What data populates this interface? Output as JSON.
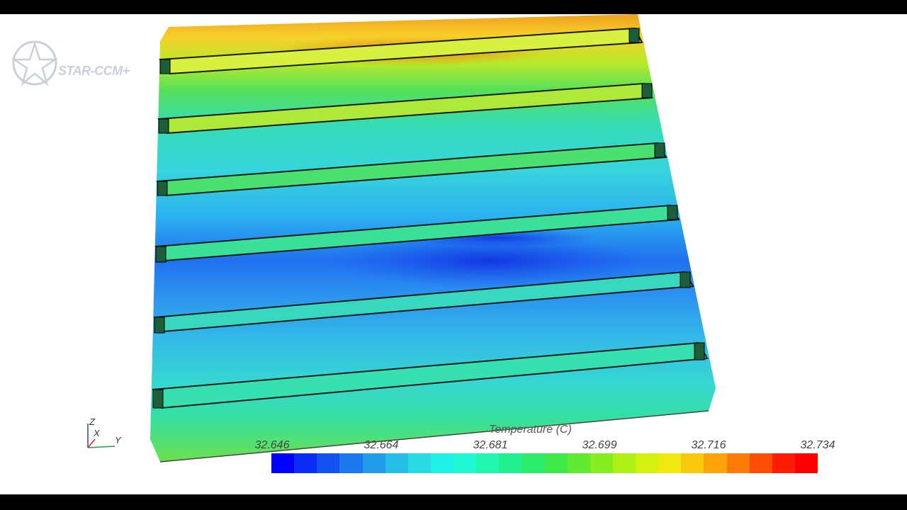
{
  "app": {
    "logo_text": "STAR-CCM+"
  },
  "axes": {
    "z": "Z",
    "x": "X",
    "y": "Y"
  },
  "legend": {
    "title": "Temperature (C)",
    "ticks": [
      "32.646",
      "32.664",
      "32.681",
      "32.699",
      "32.716",
      "32.734"
    ],
    "colors": [
      "#0000ff",
      "#0a2cf5",
      "#1352f0",
      "#1c78ec",
      "#229be8",
      "#25bde4",
      "#28d9e2",
      "#20f0e6",
      "#1ff8d0",
      "#22f5ae",
      "#23f08e",
      "#2aeb6a",
      "#3ee848",
      "#60ea30",
      "#86ee20",
      "#aef016",
      "#d4f010",
      "#f0e80e",
      "#f8c80c",
      "#fca40a",
      "#fd7c08",
      "#fe4e06",
      "#ff1c04",
      "#ff0000"
    ]
  },
  "scene": {
    "bands": [
      "#f7b400",
      "#9be022",
      "#30e09a",
      "#3ad6d4",
      "#2ab0f0",
      "#1f7ef2",
      "#1a5ef0",
      "#2a9cf2",
      "#35c6e8",
      "#34dcc8",
      "#2fe08a",
      "#6ee040"
    ]
  }
}
